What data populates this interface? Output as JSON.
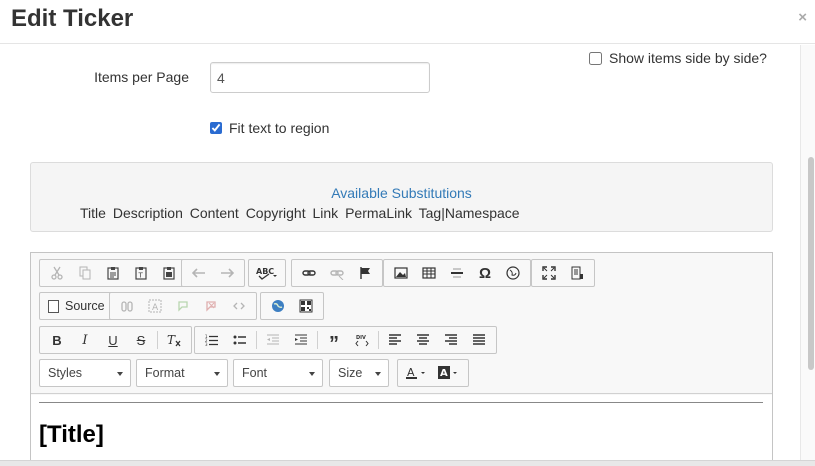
{
  "dialog": {
    "title": "Edit Ticker",
    "close": "×"
  },
  "form": {
    "show_side_by_side_label": "Show items side by side?",
    "show_side_by_side_checked": false,
    "items_per_page_label": "Items per Page",
    "items_per_page_value": "4",
    "fit_text_label": "Fit text to region",
    "fit_text_checked": true
  },
  "substitutions": {
    "title": "Available Substitutions",
    "items": [
      "Title",
      "Description",
      "Content",
      "Copyright",
      "Link",
      "PermaLink",
      "Tag|Namespace"
    ]
  },
  "editor": {
    "source_label": "Source",
    "styles_label": "Styles",
    "format_label": "Format",
    "font_label": "Font",
    "size_label": "Size",
    "content_title": "[Title]"
  },
  "colors": {
    "link": "#337ab7",
    "accent": "#2a6bd1"
  }
}
